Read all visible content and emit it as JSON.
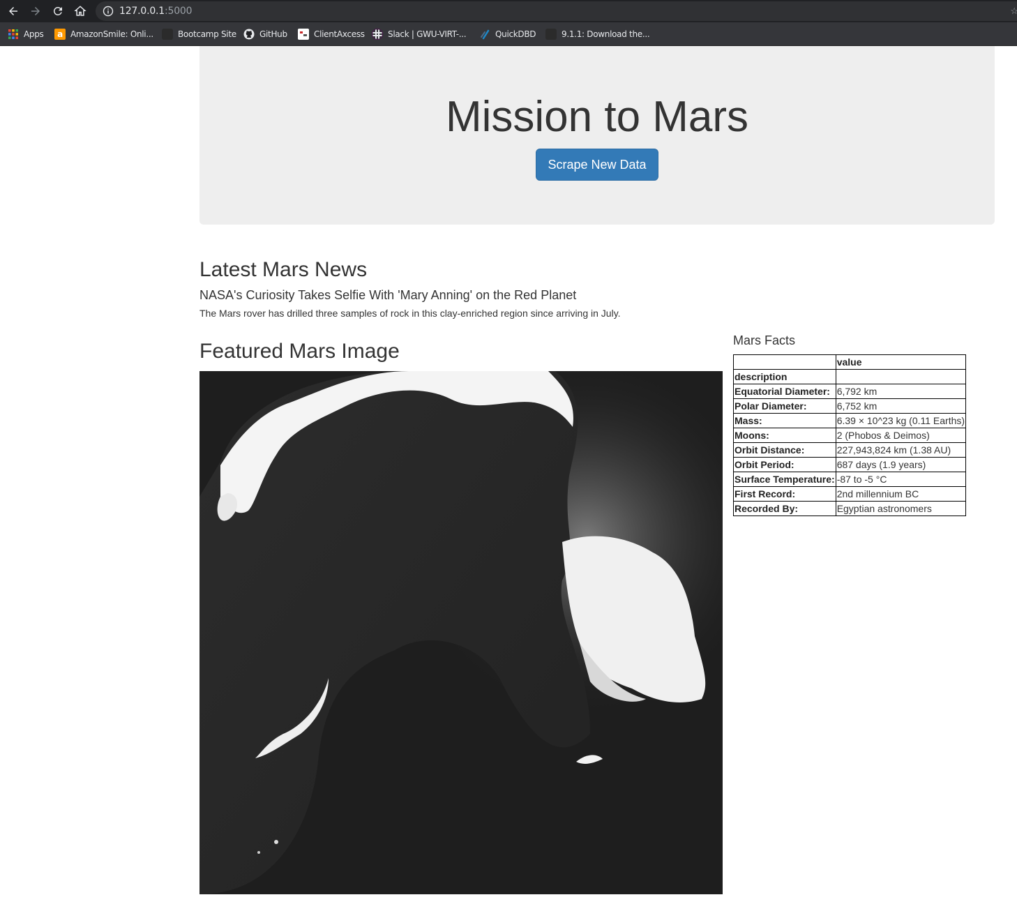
{
  "browser": {
    "url_host": "127.0.0.1",
    "url_port": ":5000",
    "bookmarks": [
      {
        "label": "Apps",
        "icon": "apps-grid-icon"
      },
      {
        "label": "AmazonSmile: Onli...",
        "icon": "amazon-icon"
      },
      {
        "label": "Bootcamp Site",
        "icon": "bootcamp-icon"
      },
      {
        "label": "GitHub",
        "icon": "github-icon"
      },
      {
        "label": "ClientAxcess",
        "icon": "clientaxcess-icon"
      },
      {
        "label": "Slack | GWU-VIRT-...",
        "icon": "slack-icon"
      },
      {
        "label": "QuickDBD",
        "icon": "quickdbd-icon"
      },
      {
        "label": "9.1.1: Download the...",
        "icon": "page-icon"
      }
    ]
  },
  "jumbotron": {
    "title": "Mission to Mars",
    "button_label": "Scrape New Data",
    "button_color": "#337ab7"
  },
  "news": {
    "heading": "Latest Mars News",
    "title": "NASA's Curiosity Takes Selfie With 'Mary Anning' on the Red Planet",
    "paragraph": "The Mars rover has drilled three samples of rock in this clay-enriched region since arriving in July."
  },
  "featured": {
    "heading": "Featured Mars Image"
  },
  "facts": {
    "heading": "Mars Facts",
    "header_value": "value",
    "rows": [
      {
        "label": "description",
        "value": ""
      },
      {
        "label": "Equatorial Diameter:",
        "value": "6,792 km"
      },
      {
        "label": "Polar Diameter:",
        "value": "6,752 km"
      },
      {
        "label": "Mass:",
        "value": "6.39 × 10^23 kg (0.11 Earths)"
      },
      {
        "label": "Moons:",
        "value": "2 (Phobos & Deimos)"
      },
      {
        "label": "Orbit Distance:",
        "value": "227,943,824 km (1.38 AU)"
      },
      {
        "label": "Orbit Period:",
        "value": "687 days (1.9 years)"
      },
      {
        "label": "Surface Temperature:",
        "value": "-87 to -5 °C"
      },
      {
        "label": "First Record:",
        "value": "2nd millennium BC"
      },
      {
        "label": "Recorded By:",
        "value": "Egyptian astronomers"
      }
    ]
  }
}
